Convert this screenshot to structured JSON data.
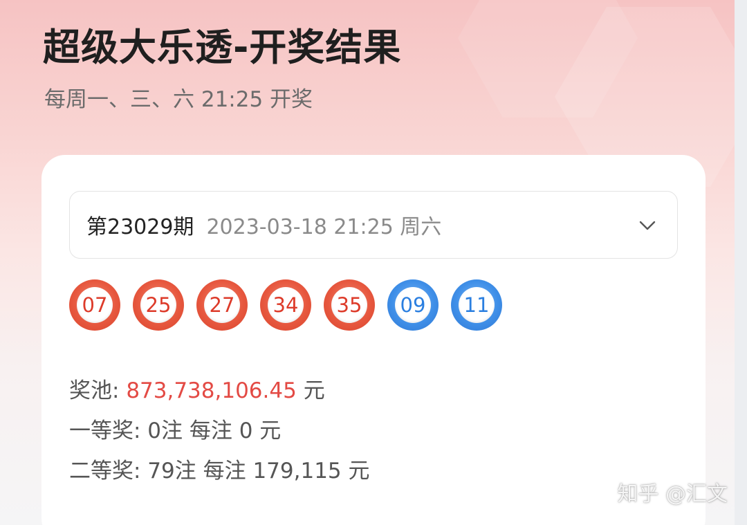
{
  "header": {
    "title": "超级大乐透-开奖结果",
    "subtitle": "每周一、三、六 21:25 开奖"
  },
  "draw_selector": {
    "period": "第23029期",
    "datetime": "2023-03-18 21:25 周六",
    "icon": "chevron-down-icon"
  },
  "balls": {
    "front": [
      "07",
      "25",
      "27",
      "34",
      "35"
    ],
    "back": [
      "09",
      "11"
    ],
    "front_color": "#e7583f",
    "back_color": "#3f8fe8"
  },
  "info": {
    "pool_label": "奖池: ",
    "pool_value": "873,738,106.45",
    "pool_unit": " 元",
    "first_prize": "一等奖: 0注 每注 0 元",
    "second_prize": "二等奖: 79注 每注 179,115 元"
  },
  "watermark": "知乎 @汇文"
}
